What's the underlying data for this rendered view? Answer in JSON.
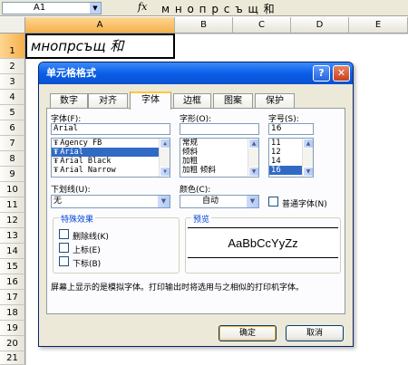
{
  "formula_bar": {
    "name_box": "A1",
    "fx_icon": "fx-icon",
    "formula": "м н о п р с ъ щ 和"
  },
  "sheet": {
    "columns": [
      "A",
      "B",
      "C",
      "D",
      "E"
    ],
    "rows": [
      "1",
      "2",
      "3",
      "4",
      "5",
      "6",
      "7",
      "8",
      "9",
      "10",
      "11",
      "12",
      "13",
      "14",
      "15",
      "16",
      "17",
      "18",
      "19",
      "20",
      "21"
    ],
    "a1_value": "мнопрсъщ 和"
  },
  "dialog": {
    "title": "单元格格式",
    "help": "?",
    "close": "✕",
    "tabs": [
      "数字",
      "对齐",
      "字体",
      "边框",
      "图案",
      "保护"
    ],
    "active_tab": "字体",
    "font": {
      "label": "字体(F):",
      "value": "Arial",
      "items": [
        "Agency FB",
        "Arial",
        "Arial Black",
        "Arial Narrow"
      ],
      "selected": "Arial"
    },
    "style": {
      "label": "字形(O):",
      "value": "",
      "items": [
        "常规",
        "倾斜",
        "加粗",
        "加粗 倾斜"
      ]
    },
    "size": {
      "label": "字号(S):",
      "value": "16",
      "items": [
        "11",
        "12",
        "14",
        "16"
      ],
      "selected": "16"
    },
    "underline": {
      "label": "下划线(U):",
      "value": "无"
    },
    "color": {
      "label": "颜色(C):",
      "value": "自动"
    },
    "normal_font": {
      "label": "普通字体(N)",
      "checked": false
    },
    "effects": {
      "title": "特殊效果",
      "strikethrough": "删除线(K)",
      "superscript": "上标(E)",
      "subscript": "下标(B)"
    },
    "preview": {
      "title": "预览",
      "sample": "AaBbCcYyZz"
    },
    "note": "屏幕上显示的是模拟字体。打印输出时将选用与之相似的打印机字体。",
    "ok": "确定",
    "cancel": "取消"
  },
  "colors": {
    "titlebar": "#0a5ee8",
    "selection": "#316ac5",
    "dialog_bg": "#ece9d8",
    "active_tab_accent": "#ffc83c"
  }
}
